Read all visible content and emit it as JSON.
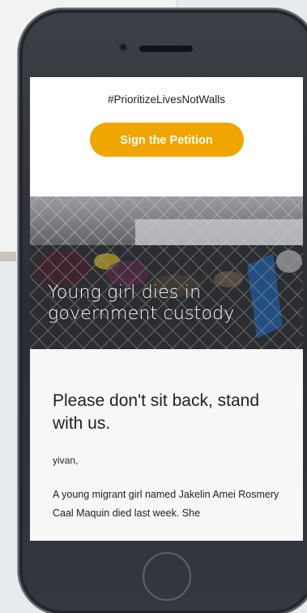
{
  "email": {
    "hashtag": "#PrioritizeLivesNotWalls",
    "cta_label": "Sign the Petition",
    "hero": {
      "title_line1": "Young girl dies in",
      "title_line2": "government custody"
    },
    "headline": "Please don't sit back, stand with us.",
    "greeting": "yivan,",
    "paragraph": "A young migrant girl named Jakelin Amei Rosmery Caal Maquin died last week. She"
  },
  "colors": {
    "cta": "#f0a500",
    "phone_frame": "#2a2d33",
    "body_bg": "#f7f7f7"
  },
  "icons": {
    "home": "home-button-icon",
    "speaker": "speaker-grille-icon",
    "camera": "front-camera-icon"
  }
}
